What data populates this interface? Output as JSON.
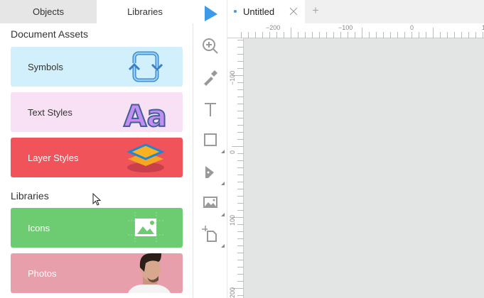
{
  "sidebar": {
    "tabs": [
      {
        "label": "Objects"
      },
      {
        "label": "Libraries"
      }
    ],
    "document_assets_heading": "Document Assets",
    "document_assets": [
      {
        "label": "Symbols",
        "color": "#d2f0fb"
      },
      {
        "label": "Text Styles",
        "color": "#f9e1f5"
      },
      {
        "label": "Layer Styles",
        "color": "#f0545a"
      }
    ],
    "libraries_heading": "Libraries",
    "libraries": [
      {
        "label": "Icons",
        "color": "#6dcb72"
      },
      {
        "label": "Photos",
        "color": "#e7a0ab"
      }
    ]
  },
  "toolbar": {
    "accent": "#3d9ae8"
  },
  "document_tab": {
    "title": "Untitled",
    "new_tab": "+"
  },
  "rulers": {
    "horizontal": [
      "−200",
      "−100",
      "0",
      "1"
    ],
    "vertical": [
      "−100",
      "0",
      "100",
      "200"
    ]
  }
}
